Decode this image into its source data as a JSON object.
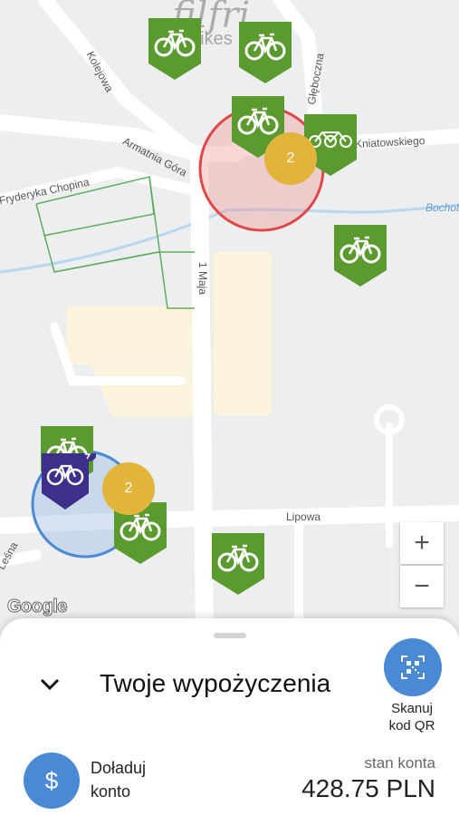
{
  "brand": {
    "name": "filfri",
    "sub": "bikes"
  },
  "map": {
    "streets": [
      "Kolejowa",
      "Armatnia Góra",
      "Fryderyka Chopina",
      "Głęboczna",
      "Kniatowskiego",
      "1 Maja",
      "Lipowa",
      "Leśna",
      "Bochotnica"
    ],
    "clusters": [
      "2",
      "2"
    ],
    "zoom_in": "+",
    "zoom_out": "−",
    "attribution": "Google"
  },
  "sheet": {
    "title": "Twoje wypożyczenia",
    "qr_label": "Skanuj\nkod QR",
    "topup_icon": "$",
    "topup_label": "Doładuj\nkonto",
    "balance_label": "stan konta",
    "balance_value": "428.75 PLN"
  },
  "colors": {
    "station_green": "#5b9a2e",
    "ebike_purple": "#3d2f8a",
    "cluster_yellow": "#e3b43a",
    "accent_blue": "#4a8ad4",
    "zone_red": "#e04848"
  }
}
